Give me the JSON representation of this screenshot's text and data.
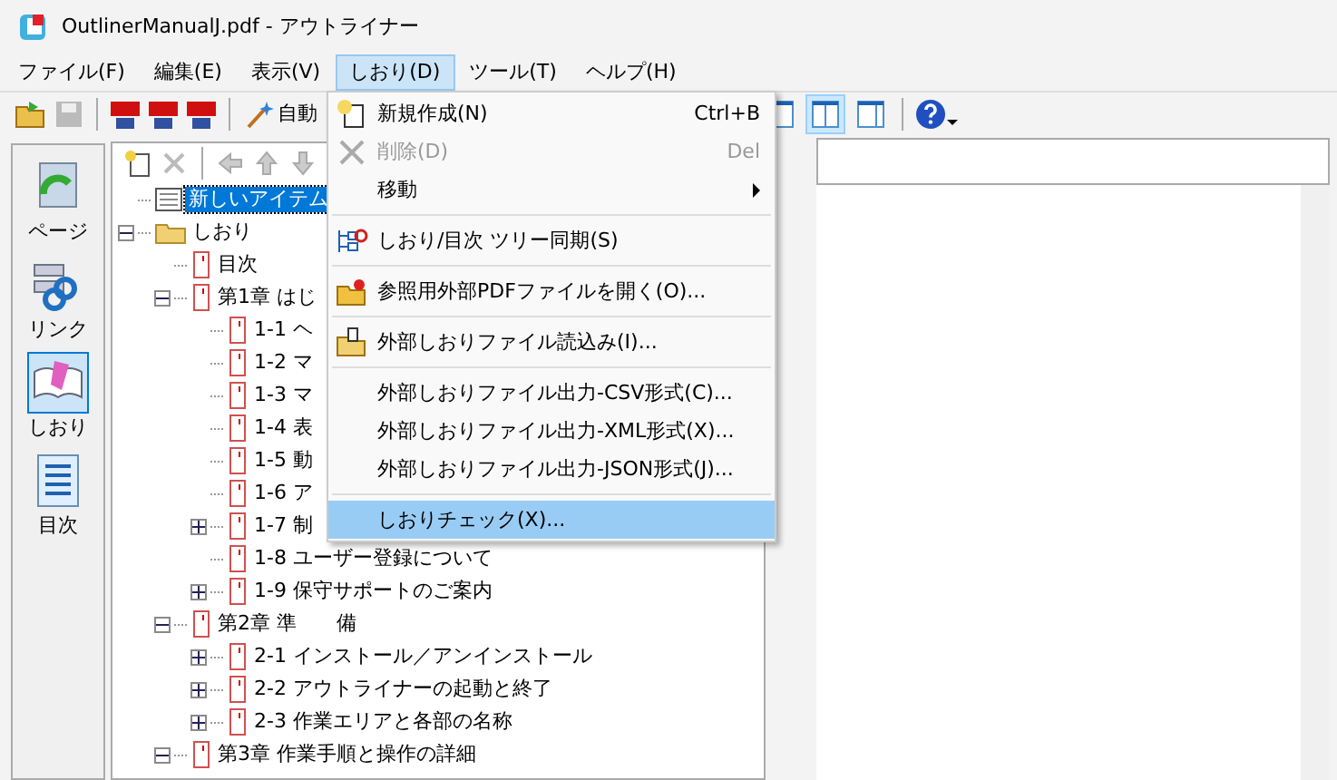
{
  "window": {
    "title": "OutlinerManualJ.pdf - アウトライナー"
  },
  "menu_bar": [
    {
      "label": "ファイル(F)",
      "selected": false
    },
    {
      "label": "編集(E)",
      "selected": false
    },
    {
      "label": "表示(V)",
      "selected": false
    },
    {
      "label": "しおり(D)",
      "selected": true
    },
    {
      "label": "ツール(T)",
      "selected": false
    },
    {
      "label": "ヘルプ(H)",
      "selected": false
    }
  ],
  "toolbar": {
    "auto_button": "自動",
    "layouts": [
      {
        "kind": "left",
        "selected": false
      },
      {
        "kind": "middle",
        "selected": true
      },
      {
        "kind": "right",
        "selected": false
      }
    ]
  },
  "sidebar": [
    {
      "label": "ページ",
      "kind": "page",
      "selected": false
    },
    {
      "label": "リンク",
      "kind": "link",
      "selected": false
    },
    {
      "label": "しおり",
      "kind": "bookmark",
      "selected": true
    },
    {
      "label": "目次",
      "kind": "toc",
      "selected": false
    }
  ],
  "tree": [
    {
      "label": "新しいアイテム",
      "kind": "item",
      "selected": true
    },
    {
      "label": "しおり",
      "kind": "folder",
      "selected": false,
      "expanded": true,
      "children": [
        {
          "label": "目次",
          "kind": "page",
          "selected": false
        },
        {
          "label": "第1章 はじ",
          "kind": "page",
          "selected": false,
          "expanded": true,
          "children": [
            {
              "label": "1-1 ヘ",
              "kind": "page",
              "selected": false
            },
            {
              "label": "1-2 マ",
              "kind": "page",
              "selected": false
            },
            {
              "label": "1-3 マ",
              "kind": "page",
              "selected": false
            },
            {
              "label": "1-4 表",
              "kind": "page",
              "selected": false
            },
            {
              "label": "1-5 動",
              "kind": "page",
              "selected": false
            },
            {
              "label": "1-6 ア",
              "kind": "page",
              "selected": false
            },
            {
              "label": "1-7 制",
              "kind": "page",
              "selected": false,
              "expanded": false
            },
            {
              "label": "1-8 ユーザー登録について",
              "kind": "page",
              "selected": false
            },
            {
              "label": "1-9 保守サポートのご案内",
              "kind": "page",
              "selected": false,
              "expanded": false
            }
          ]
        },
        {
          "label": "第2章 準　　備",
          "kind": "page",
          "selected": false,
          "expanded": true,
          "children": [
            {
              "label": "2-1 インストール／アンインストール",
              "kind": "page",
              "selected": false,
              "expanded": false
            },
            {
              "label": "2-2 アウトライナーの起動と終了",
              "kind": "page",
              "selected": false,
              "expanded": false
            },
            {
              "label": "2-3 作業エリアと各部の名称",
              "kind": "page",
              "selected": false,
              "expanded": false
            }
          ]
        },
        {
          "label": "第3章 作業手順と操作の詳細",
          "kind": "page",
          "selected": false,
          "expanded": true
        }
      ]
    }
  ],
  "dropdown_menu": [
    {
      "kind": "new",
      "label": "新規作成(N)",
      "shortcut": "Ctrl+B",
      "disabled": false,
      "selected": false
    },
    {
      "kind": "delete",
      "label": "削除(D)",
      "shortcut": "Del",
      "disabled": true,
      "selected": false
    },
    {
      "kind": "submenu",
      "label": "移動",
      "disabled": false,
      "selected": false
    },
    {
      "kind": "separator"
    },
    {
      "kind": "sync",
      "label": "しおり/目次 ツリー同期(S)",
      "disabled": false,
      "selected": false
    },
    {
      "kind": "separator"
    },
    {
      "kind": "open",
      "label": "参照用外部PDFファイルを開く(O)...",
      "disabled": false,
      "selected": false
    },
    {
      "kind": "separator"
    },
    {
      "kind": "import",
      "label": "外部しおりファイル読込み(I)...",
      "disabled": false,
      "selected": false
    },
    {
      "kind": "separator"
    },
    {
      "kind": "item",
      "label": "外部しおりファイル出力-CSV形式(C)...",
      "disabled": false,
      "selected": false
    },
    {
      "kind": "item",
      "label": "外部しおりファイル出力-XML形式(X)...",
      "disabled": false,
      "selected": false
    },
    {
      "kind": "item",
      "label": "外部しおりファイル出力-JSON形式(J)...",
      "disabled": false,
      "selected": false
    },
    {
      "kind": "separator"
    },
    {
      "kind": "item",
      "label": "しおりチェック(X)...",
      "disabled": false,
      "selected": true
    }
  ]
}
